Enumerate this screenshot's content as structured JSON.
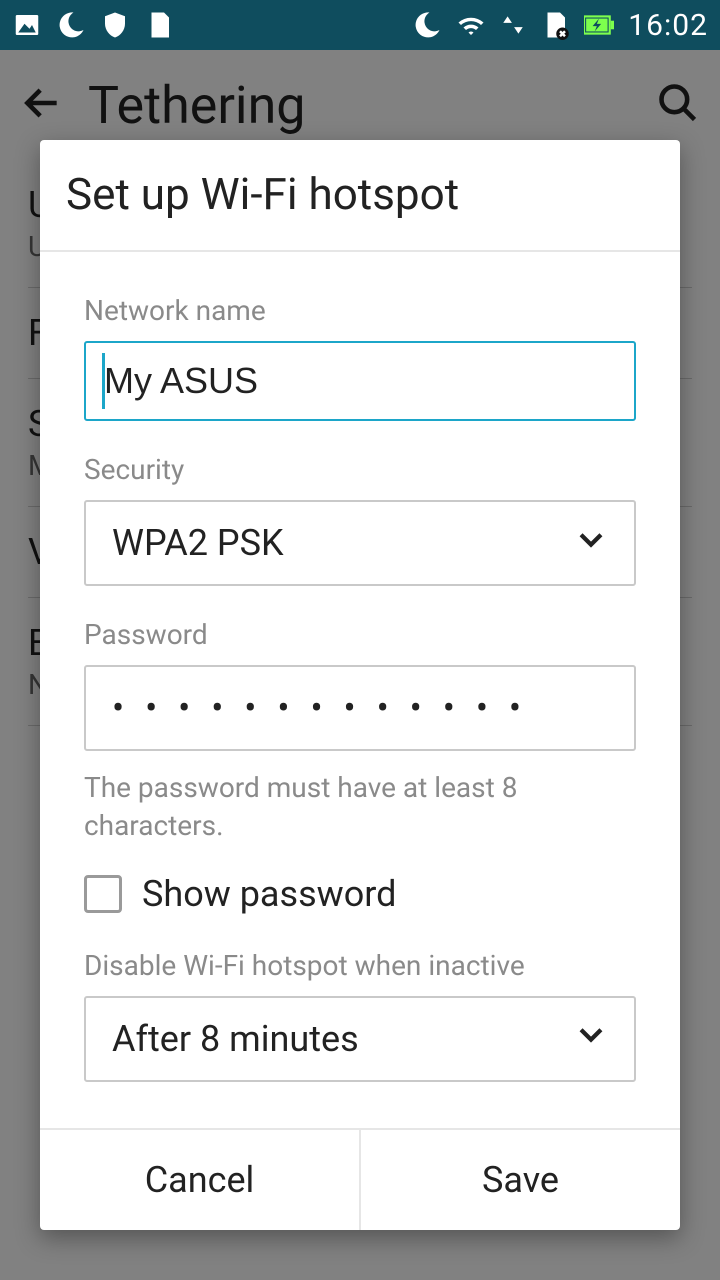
{
  "statusbar": {
    "time": "16:02"
  },
  "bg": {
    "title": "Tethering",
    "items": [
      {
        "t": "U",
        "s": "U"
      },
      {
        "t": "F",
        "s": ""
      },
      {
        "t": "S",
        "s": "M"
      },
      {
        "t": "V",
        "s": ""
      },
      {
        "t": "E",
        "s": "N"
      }
    ]
  },
  "dialog": {
    "title": "Set up Wi-Fi hotspot",
    "network_label": "Network name",
    "network_value": "My ASUS",
    "security_label": "Security",
    "security_value": "WPA2 PSK",
    "password_label": "Password",
    "password_mask": "•   •  •  •  •  •  •  •  •  •  •  •  •",
    "password_hint": "The password must have at least 8 characters.",
    "show_password_label": "Show password",
    "timeout_label": "Disable Wi-Fi hotspot when inactive",
    "timeout_value": "After 8 minutes",
    "cancel": "Cancel",
    "save": "Save"
  }
}
